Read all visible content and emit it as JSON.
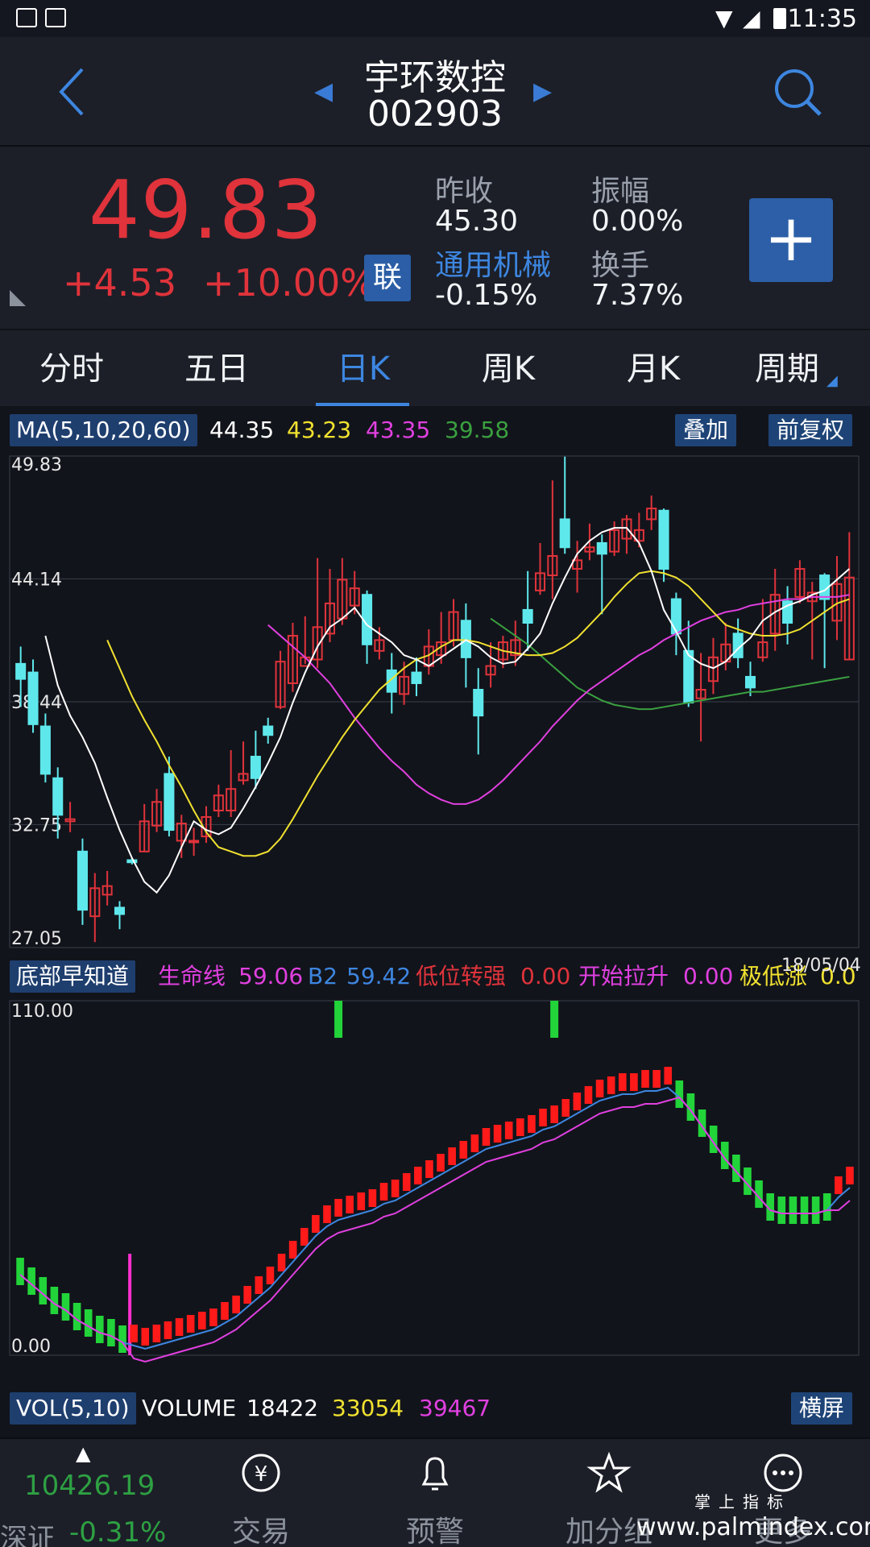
{
  "status_bar": {
    "time": "11:35"
  },
  "header": {
    "stock_name": "宇环数控",
    "stock_code": "002903"
  },
  "quote": {
    "price": "49.83",
    "change": "+4.53",
    "change_pct": "+10.00%",
    "lian_label": "联",
    "prev_close_label": "昨收",
    "prev_close": "45.30",
    "amplitude_label": "振幅",
    "amplitude": "0.00%",
    "sector_label": "通用机械",
    "sector_change": "-0.15%",
    "turnover_label": "换手",
    "turnover": "7.37%",
    "add_button": "+"
  },
  "tabs": [
    "分时",
    "五日",
    "日K",
    "周K",
    "月K",
    "周期"
  ],
  "active_tab": "日K",
  "ma_legend": {
    "label": "MA(5,10,20,60)",
    "values": [
      "44.35",
      "43.23",
      "43.35",
      "39.58"
    ],
    "colors": [
      "#ffffff",
      "#f0e130",
      "#e040e0",
      "#3aa040"
    ]
  },
  "overlay_button": "叠加",
  "adjust_button": "前复权",
  "indicator_legend": {
    "label": "底部早知道",
    "life_line_label": "生命线",
    "life_line": "59.06",
    "b2_label": "B2",
    "b2": "59.42",
    "low_strong_label": "低位转强",
    "low_strong": "0.00",
    "start_rise_label": "开始拉升",
    "start_rise": "0.00",
    "extreme_low_label": "极低涨",
    "extreme_low": "0.0",
    "date": "18/05/04"
  },
  "vol_legend": {
    "label": "VOL(5,10)",
    "volume_label": "VOLUME",
    "volume": "18422",
    "ma5": "33054",
    "ma10": "39467"
  },
  "landscape_button": "横屏",
  "bottom_nav": {
    "index_value": "10426.19",
    "index_name": "深证",
    "index_pct": "-0.31%",
    "items": [
      "交易",
      "预警",
      "加分组",
      "更多"
    ]
  },
  "watermark": {
    "text": "www.palmindex.com",
    "cn": "掌上指标"
  },
  "colors": {
    "up": "#e0333b",
    "down": "#5ee8ec",
    "accent": "#3d86e0",
    "green": "#2ea043"
  },
  "chart_data": [
    {
      "type": "candlestick",
      "title": "MA(5,10,20,60)",
      "y_ticks": [
        "49.83",
        "44.14",
        "38.44",
        "32.75",
        "27.05"
      ],
      "ylim": [
        27.05,
        49.83
      ],
      "candles": [
        [
          40.2,
          39.5,
          41.0,
          38.2
        ],
        [
          39.8,
          37.4,
          40.4,
          37.0
        ],
        [
          37.3,
          35.1,
          37.9,
          34.7
        ],
        [
          34.9,
          33.2,
          35.4,
          32.1
        ],
        [
          32.9,
          33.0,
          33.8,
          32.4
        ],
        [
          31.5,
          28.8,
          32.1,
          28.1
        ],
        [
          28.5,
          29.8,
          30.5,
          27.3
        ],
        [
          29.5,
          29.9,
          30.6,
          29.0
        ],
        [
          28.9,
          28.6,
          29.2,
          27.9
        ],
        [
          31.1,
          31.0,
          31.2,
          30.9
        ],
        [
          31.5,
          32.9,
          33.7,
          31.5
        ],
        [
          32.7,
          33.8,
          34.4,
          32.4
        ],
        [
          35.1,
          32.5,
          35.9,
          32.2
        ],
        [
          32.0,
          32.8,
          33.2,
          31.2
        ],
        [
          32.0,
          32.0,
          32.6,
          31.3
        ],
        [
          32.2,
          33.1,
          33.6,
          31.9
        ],
        [
          33.4,
          34.1,
          34.6,
          33.1
        ],
        [
          33.4,
          34.4,
          36.2,
          33.1
        ],
        [
          34.8,
          35.1,
          36.6,
          34.6
        ],
        [
          35.9,
          34.9,
          37.1,
          34.4
        ],
        [
          37.3,
          36.9,
          37.7,
          36.5
        ],
        [
          38.2,
          40.3,
          40.8,
          38.1
        ],
        [
          39.3,
          41.5,
          42.1,
          38.9
        ],
        [
          40.1,
          40.5,
          42.4,
          40.2
        ],
        [
          40.4,
          41.9,
          45.1,
          40.0
        ],
        [
          41.6,
          43.0,
          44.6,
          41.2
        ],
        [
          42.3,
          44.1,
          45.1,
          42.0
        ],
        [
          42.9,
          43.7,
          44.5,
          42.5
        ],
        [
          43.4,
          41.1,
          43.6,
          40.2
        ],
        [
          40.8,
          41.3,
          41.9,
          40.4
        ],
        [
          39.9,
          38.9,
          40.7,
          37.9
        ],
        [
          38.8,
          39.6,
          40.3,
          38.3
        ],
        [
          39.8,
          39.3,
          40.5,
          38.7
        ],
        [
          40.1,
          41.0,
          41.8,
          39.7
        ],
        [
          40.6,
          41.2,
          42.6,
          40.2
        ],
        [
          41.3,
          42.6,
          43.2,
          41.0
        ],
        [
          42.2,
          40.5,
          43.0,
          39.1
        ],
        [
          39.0,
          37.8,
          40.0,
          36.0
        ],
        [
          39.7,
          40.1,
          41.2,
          39.1
        ],
        [
          40.4,
          41.2,
          41.5,
          40.0
        ],
        [
          40.6,
          41.3,
          42.2,
          40.1
        ],
        [
          42.7,
          42.1,
          44.5,
          40.8
        ],
        [
          43.6,
          44.4,
          45.8,
          43.4
        ],
        [
          44.3,
          45.2,
          48.7,
          43.2
        ],
        [
          46.9,
          45.6,
          49.8,
          45.3
        ],
        [
          44.6,
          45.0,
          45.9,
          43.5
        ],
        [
          45.4,
          45.6,
          46.7,
          45.0
        ],
        [
          45.8,
          45.3,
          46.2,
          42.5
        ],
        [
          45.4,
          46.4,
          46.8,
          45.2
        ],
        [
          46.0,
          46.9,
          47.1,
          45.3
        ],
        [
          45.9,
          46.4,
          47.2,
          45.6
        ],
        [
          46.9,
          47.4,
          48.0,
          46.4
        ],
        [
          47.3,
          44.6,
          47.4,
          44.0
        ],
        [
          43.2,
          41.6,
          43.5,
          40.6
        ],
        [
          40.8,
          38.4,
          42.2,
          38.2
        ],
        [
          38.6,
          39.0,
          40.7,
          36.6
        ],
        [
          39.4,
          40.5,
          41.4,
          38.8
        ],
        [
          40.3,
          41.1,
          42.1,
          39.9
        ],
        [
          41.6,
          40.5,
          42.3,
          40.0
        ],
        [
          39.6,
          39.1,
          40.3,
          38.7
        ],
        [
          40.5,
          41.2,
          43.2,
          40.3
        ],
        [
          41.6,
          43.4,
          44.6,
          40.8
        ],
        [
          43.1,
          42.1,
          43.8,
          41.1
        ],
        [
          43.3,
          44.6,
          45.0,
          43.0
        ],
        [
          43.1,
          43.5,
          44.0,
          40.4
        ],
        [
          44.3,
          43.2,
          44.4,
          40.0
        ],
        [
          42.2,
          43.9,
          45.2,
          41.3
        ],
        [
          40.4,
          44.2,
          46.3,
          40.4
        ]
      ],
      "ma5": [
        41.5,
        39.2,
        37.8,
        36.8,
        35.6,
        34.0,
        32.5,
        31.2,
        30.1,
        29.6,
        30.4,
        31.7,
        32.9,
        32.5,
        32.3,
        32.6,
        33.5,
        34.5,
        35.6,
        36.8,
        38.4,
        39.8,
        41.0,
        41.9,
        42.3,
        42.8,
        42.0,
        41.6,
        41.2,
        40.6,
        40.4,
        40.1,
        40.5,
        40.9,
        41.3,
        41.0,
        40.5,
        40.2,
        40.3,
        40.9,
        41.6,
        43.0,
        44.2,
        45.3,
        45.9,
        46.3,
        46.5,
        46.5,
        45.8,
        44.5,
        42.7,
        41.7,
        40.6,
        40.2,
        40.0,
        40.3,
        40.9,
        41.4,
        42.2,
        42.6,
        42.9,
        43.1,
        43.4,
        43.6,
        44.1,
        44.6
      ],
      "ma10": [
        41.3,
        40.0,
        38.7,
        37.6,
        36.6,
        35.5,
        34.5,
        33.4,
        32.4,
        31.7,
        31.5,
        31.3,
        31.3,
        31.5,
        32.1,
        33.0,
        34.0,
        35.0,
        35.9,
        36.8,
        37.6,
        38.3,
        39.0,
        39.5,
        40.0,
        40.4,
        40.6,
        41.0,
        41.3,
        41.3,
        41.2,
        41.0,
        40.8,
        40.7,
        40.6,
        40.6,
        40.7,
        41.0,
        41.4,
        42.0,
        42.6,
        43.3,
        43.9,
        44.4,
        44.5,
        44.4,
        44.2,
        43.8,
        43.2,
        42.6,
        42.0,
        41.8,
        41.6,
        41.5,
        41.5,
        41.6,
        41.8,
        42.2,
        42.6,
        43.0,
        43.2
      ],
      "ma20": [
        42.0,
        41.5,
        41.0,
        40.5,
        39.9,
        39.3,
        38.5,
        37.7,
        37.0,
        36.3,
        35.7,
        35.2,
        34.6,
        34.2,
        33.9,
        33.7,
        33.7,
        33.9,
        34.3,
        34.8,
        35.4,
        36.0,
        36.6,
        37.3,
        37.9,
        38.5,
        39.0,
        39.4,
        39.8,
        40.2,
        40.6,
        40.9,
        41.3,
        41.6,
        41.9,
        42.2,
        42.4,
        42.6,
        42.7,
        42.9,
        43.0,
        43.1,
        43.2,
        43.2,
        43.3,
        43.3,
        43.3,
        43.4
      ],
      "ma60": [
        42.3,
        41.9,
        41.5,
        41.1,
        40.6,
        40.1,
        39.6,
        39.1,
        38.8,
        38.5,
        38.3,
        38.2,
        38.1,
        38.1,
        38.2,
        38.3,
        38.4,
        38.5,
        38.6,
        38.7,
        38.8,
        38.9,
        38.9,
        39.0,
        39.1,
        39.2,
        39.3,
        39.4,
        39.5,
        39.6
      ]
    },
    {
      "type": "bar",
      "title": "底部早知道",
      "ylim": [
        0,
        110
      ],
      "y_ticks": [
        "110.00",
        "0.00"
      ],
      "values": [
        26,
        23,
        20,
        17,
        15,
        12,
        10,
        8,
        7,
        5,
        4,
        3,
        4,
        5,
        6,
        7,
        8,
        9,
        11,
        13,
        16,
        19,
        22,
        26,
        30,
        34,
        38,
        41,
        43,
        44,
        45,
        46,
        48,
        49,
        51,
        53,
        55,
        57,
        59,
        61,
        63,
        65,
        66,
        67,
        68,
        69,
        71,
        72,
        74,
        76,
        78,
        80,
        81,
        82,
        82,
        83,
        83,
        84,
        81,
        77,
        72,
        67,
        62,
        58,
        54,
        50,
        46,
        45,
        45,
        45,
        45,
        46,
        50,
        53
      ],
      "up_flags": [
        0,
        0,
        0,
        0,
        0,
        0,
        0,
        0,
        0,
        0,
        1,
        1,
        1,
        1,
        1,
        1,
        1,
        1,
        1,
        1,
        1,
        1,
        1,
        1,
        1,
        1,
        1,
        1,
        1,
        1,
        1,
        1,
        1,
        1,
        1,
        1,
        1,
        1,
        1,
        1,
        1,
        1,
        1,
        1,
        1,
        1,
        1,
        1,
        1,
        1,
        1,
        1,
        1,
        1,
        1,
        1,
        1,
        1,
        0,
        0,
        0,
        0,
        0,
        0,
        0,
        0,
        0,
        0,
        0,
        0,
        0,
        0,
        1,
        1
      ],
      "signals": [
        28,
        47
      ]
    }
  ]
}
